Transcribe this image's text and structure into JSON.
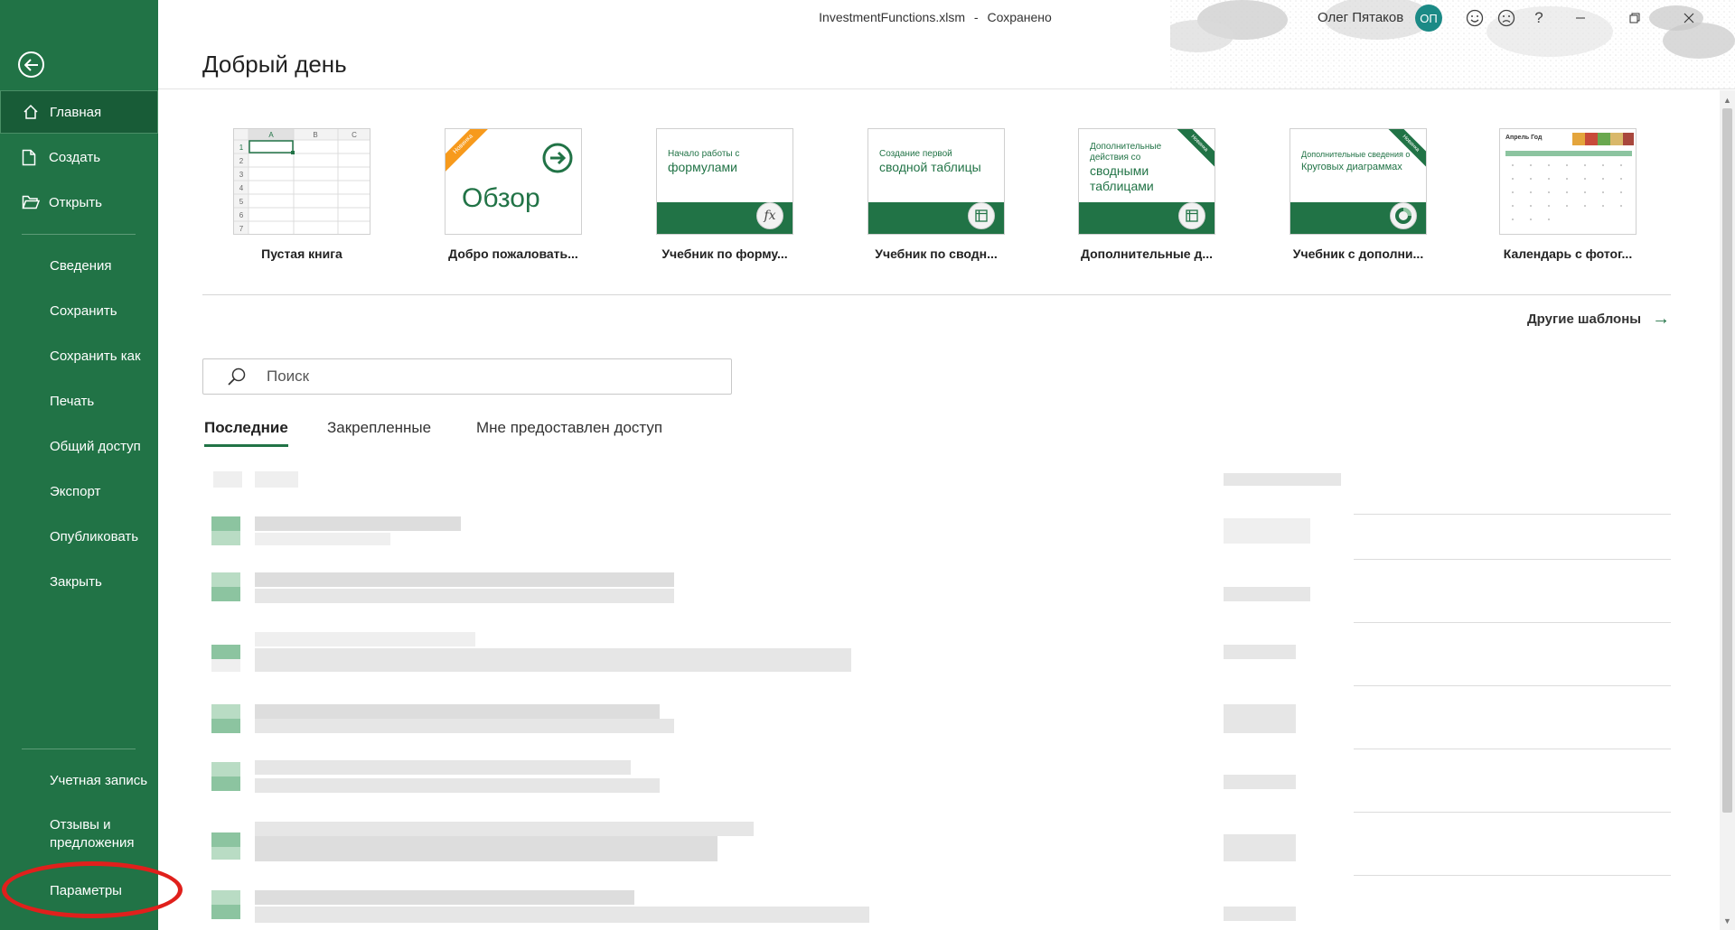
{
  "sidebar": {
    "items": [
      {
        "label": "Главная",
        "icon": "home-icon"
      },
      {
        "label": "Создать",
        "icon": "new-file-icon"
      },
      {
        "label": "Открыть",
        "icon": "folder-icon"
      },
      {
        "label": "Сведения"
      },
      {
        "label": "Сохранить"
      },
      {
        "label": "Сохранить как"
      },
      {
        "label": "Печать"
      },
      {
        "label": "Общий доступ"
      },
      {
        "label": "Экспорт"
      },
      {
        "label": "Опубликовать"
      },
      {
        "label": "Закрыть"
      }
    ],
    "bottom_items": [
      {
        "label": "Учетная запись"
      },
      {
        "label": "Отзывы и"
      },
      {
        "label": "предложения"
      },
      {
        "label": "Параметры"
      }
    ],
    "accent": "#217346",
    "highlight_color": "#e0201c"
  },
  "titlebar": {
    "document": "InvestmentFunctions.xlsm",
    "separator": "-",
    "status": "Сохранено",
    "user_name": "Олег Пятаков",
    "user_initials": "ОП"
  },
  "main": {
    "greeting": "Добрый день",
    "templates": [
      {
        "name": "Пустая книга",
        "sheet_cols": [
          "A",
          "B",
          "C"
        ],
        "sheet_rows": [
          "1",
          "2",
          "3",
          "4",
          "5",
          "6",
          "7"
        ]
      },
      {
        "name": "Добро пожаловать...",
        "thumb_text": "Обзор",
        "badge": "Новинка"
      },
      {
        "name": "Учебник по форму...",
        "thumb_small": "Начало работы с",
        "thumb_big": "формулами",
        "badge_glyph": "fx"
      },
      {
        "name": "Учебник по сводн...",
        "thumb_small": "Создание первой",
        "thumb_big": "сводной таблицы"
      },
      {
        "name": "Дополнительные д...",
        "thumb_small": "Дополнительные действия со",
        "thumb_big": "сводными таблицами",
        "badge": "Новинка"
      },
      {
        "name": "Учебник с дополни...",
        "thumb_small": "Дополнительные сведения о",
        "thumb_big": "Круговых диаграммах",
        "badge": "Новинка"
      },
      {
        "name": "Календарь с фотог...",
        "thumb_small": "Апрель Год"
      }
    ],
    "more_templates": "Другие шаблоны",
    "search": {
      "placeholder": "Поиск"
    },
    "tabs": [
      {
        "label": "Последние",
        "active": true
      },
      {
        "label": "Закрепленные"
      },
      {
        "label": "Мне предоставлен доступ"
      }
    ]
  }
}
